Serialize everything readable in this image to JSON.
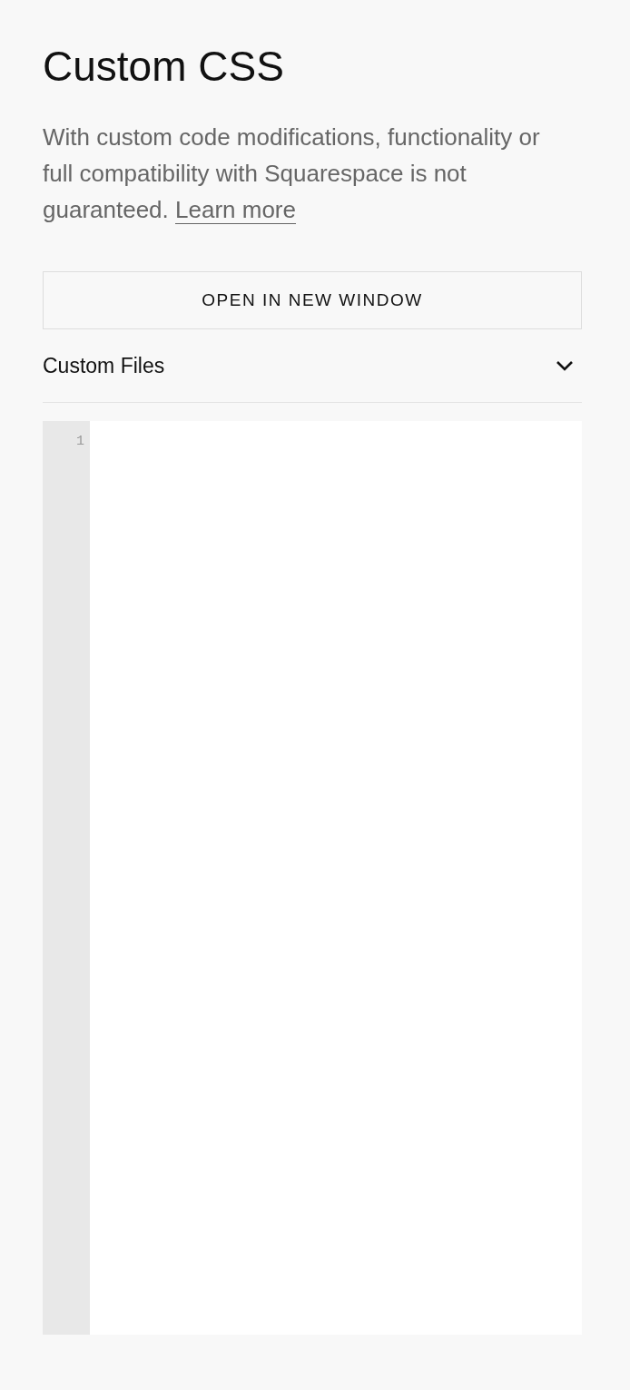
{
  "title": "Custom CSS",
  "description": {
    "text": "With custom code modifications, functionality or full compatibility with Squarespace is not guaranteed.",
    "link": "Learn more"
  },
  "button": {
    "label": "OPEN IN NEW WINDOW"
  },
  "section": {
    "label": "Custom Files",
    "expanded": false
  },
  "editor": {
    "line_numbers": [
      "1"
    ]
  }
}
